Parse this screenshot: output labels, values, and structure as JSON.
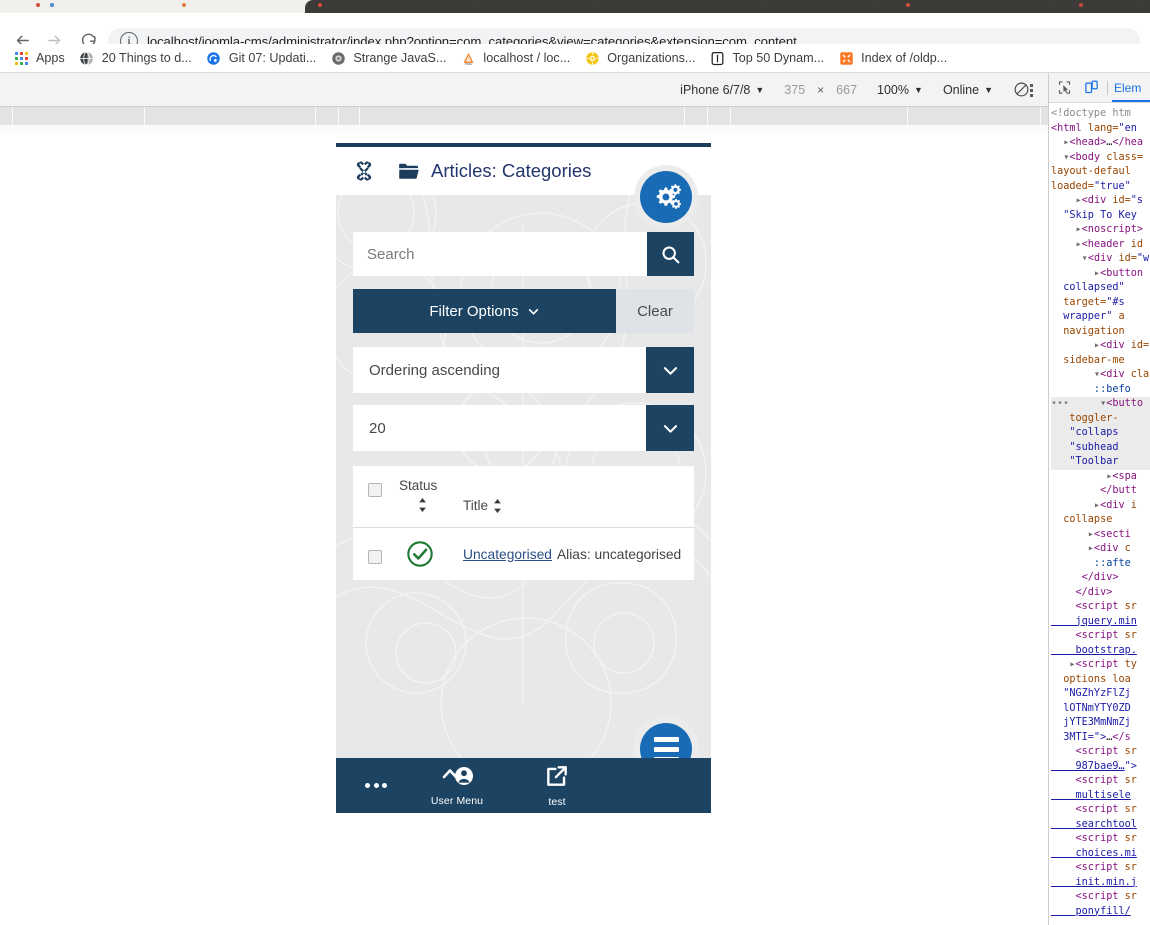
{
  "browser": {
    "url": "localhost/joomla-cms/administrator/index.php?option=com_categories&view=categories&extension=com_content",
    "back_icon": "arrow-left-icon",
    "forward_icon": "arrow-right-icon",
    "reload_icon": "reload-icon",
    "info_icon": "info-icon",
    "info_glyph": "i",
    "bookmarks": [
      {
        "label": "Apps",
        "icon": "apps-grid-icon"
      },
      {
        "label": "20 Things to d...",
        "icon": "globe-icon"
      },
      {
        "label": "Git 07: Updati...",
        "icon": "swirl-icon"
      },
      {
        "label": "Strange JavaS...",
        "icon": "circle-icon"
      },
      {
        "label": "localhost / loc...",
        "icon": "phpmyadmin-icon"
      },
      {
        "label": "Organizations...",
        "icon": "gear-yellow-icon"
      },
      {
        "label": "Top 50 Dynam...",
        "icon": "square-bracket-icon"
      },
      {
        "label": "Index of /oldp...",
        "icon": "xampp-icon"
      }
    ]
  },
  "device_toolbar": {
    "device": "iPhone 6/7/8",
    "device_caret": "chevron-down-icon",
    "width": "375",
    "times": "×",
    "height": "667",
    "zoom": "100%",
    "zoom_caret": "chevron-down-icon",
    "throttle": "Online",
    "throttle_caret": "chevron-down-icon",
    "rotate_icon": "rotate-device-icon",
    "more_icon": "kebab-menu-icon"
  },
  "viewport": {
    "header": {
      "logo_icon": "joomla-logo-icon",
      "section_icon": "folder-icon",
      "title": "Articles: Categories",
      "options_button_icon": "gears-icon"
    },
    "search": {
      "placeholder": "Search",
      "value": "",
      "button_icon": "search-icon"
    },
    "filter": {
      "options_label": "Filter Options",
      "options_caret": "chevron-down-icon",
      "clear_label": "Clear"
    },
    "ordering_select": {
      "value": "Ordering ascending",
      "caret": "chevron-down-icon"
    },
    "limit_select": {
      "value": "20",
      "caret": "chevron-down-icon"
    },
    "table": {
      "select_all_name": "select-all-checkbox",
      "columns": [
        {
          "label": "Status",
          "sortable": true
        },
        {
          "label": "Title",
          "sortable": true
        }
      ],
      "rows": [
        {
          "checked": false,
          "status_icon": "check-circle-icon",
          "status": "Published",
          "title": "Uncategorised",
          "alias": "Alias: uncategorised"
        }
      ]
    },
    "bottom_bar": {
      "items": [
        {
          "label": "",
          "icon": "ellipsis-icon",
          "name": "more-button"
        },
        {
          "label": "User Menu",
          "icon": "user-icon",
          "name": "user-menu-button"
        },
        {
          "label": "test",
          "icon": "external-link-icon",
          "name": "site-preview-button"
        }
      ],
      "menu_button_icon": "hamburger-icon"
    }
  },
  "devtools": {
    "inspect_icon": "inspect-element-icon",
    "device_toggle_icon": "device-toolbar-icon",
    "active_tab": "Elem",
    "code_lines": [
      [
        {
          "t": "com",
          "v": "<!doctype htm"
        }
      ],
      [
        {
          "t": "tag",
          "v": "<html"
        },
        {
          "t": "sp",
          "v": " "
        },
        {
          "t": "attr",
          "v": "lang="
        },
        {
          "t": "val",
          "v": "\"en"
        }
      ],
      [
        {
          "t": "tri",
          "v": "  ▸"
        },
        {
          "t": "tag",
          "v": "<head>"
        },
        {
          "t": "txt",
          "v": "…"
        },
        {
          "t": "tag",
          "v": "</hea"
        }
      ],
      [
        {
          "t": "tri",
          "v": "  ▾"
        },
        {
          "t": "tag",
          "v": "<body"
        },
        {
          "t": "sp",
          "v": " "
        },
        {
          "t": "attr",
          "v": "class="
        }
      ],
      [
        {
          "t": "attr",
          "v": "layout-defaul"
        }
      ],
      [
        {
          "t": "attr",
          "v": "loaded="
        },
        {
          "t": "val",
          "v": "\"true\""
        }
      ],
      [
        {
          "t": "tri",
          "v": "    ▸"
        },
        {
          "t": "tag",
          "v": "<div"
        },
        {
          "t": "sp",
          "v": " "
        },
        {
          "t": "attr",
          "v": "id="
        },
        {
          "t": "val",
          "v": "\"s"
        }
      ],
      [
        {
          "t": "val",
          "v": "  \"Skip To Key"
        }
      ],
      [
        {
          "t": "tri",
          "v": "    ▸"
        },
        {
          "t": "tag",
          "v": "<noscript>"
        }
      ],
      [
        {
          "t": "tri",
          "v": "    ▸"
        },
        {
          "t": "tag",
          "v": "<header"
        },
        {
          "t": "sp",
          "v": " "
        },
        {
          "t": "attr",
          "v": "id"
        }
      ],
      [
        {
          "t": "tri",
          "v": "     ▾"
        },
        {
          "t": "tag",
          "v": "<div"
        },
        {
          "t": "sp",
          "v": " "
        },
        {
          "t": "attr",
          "v": "id="
        },
        {
          "t": "val",
          "v": "\"w"
        }
      ],
      [
        {
          "t": "tri",
          "v": "       ▸"
        },
        {
          "t": "tag",
          "v": "<button"
        }
      ],
      [
        {
          "t": "val",
          "v": "  collapsed\""
        }
      ],
      [
        {
          "t": "attr",
          "v": "  target="
        },
        {
          "t": "val",
          "v": "\"#s"
        }
      ],
      [
        {
          "t": "val",
          "v": "  wrapper\""
        },
        {
          "t": "sp",
          "v": " "
        },
        {
          "t": "attr",
          "v": "a"
        }
      ],
      [
        {
          "t": "attr",
          "v": "  navigation"
        }
      ],
      [
        {
          "t": "tri",
          "v": "       ▸"
        },
        {
          "t": "tag",
          "v": "<div"
        },
        {
          "t": "sp",
          "v": " "
        },
        {
          "t": "attr",
          "v": "id="
        }
      ],
      [
        {
          "t": "attr",
          "v": "  sidebar-me"
        }
      ],
      [
        {
          "t": "tri",
          "v": "       ▾"
        },
        {
          "t": "tag",
          "v": "<div"
        },
        {
          "t": "sp",
          "v": " "
        },
        {
          "t": "attr",
          "v": "cla"
        }
      ],
      [
        {
          "t": "pseudo",
          "v": "       ::befo"
        }
      ],
      [
        {
          "t": "tri",
          "v": "        ▾"
        },
        {
          "t": "tag",
          "v": "<butto"
        }
      ],
      [
        {
          "t": "attr",
          "v": "   toggler-"
        }
      ],
      [
        {
          "t": "val",
          "v": "   \"collaps"
        }
      ],
      [
        {
          "t": "val",
          "v": "   \"subhead"
        }
      ],
      [
        {
          "t": "val",
          "v": "   \"Toolbar"
        }
      ],
      [
        {
          "t": "tri",
          "v": "         ▸"
        },
        {
          "t": "tag",
          "v": "<spa"
        }
      ],
      [
        {
          "t": "tag",
          "v": "        </butt"
        }
      ],
      [
        {
          "t": "tri",
          "v": "       ▸"
        },
        {
          "t": "tag",
          "v": "<div"
        },
        {
          "t": "sp",
          "v": " "
        },
        {
          "t": "attr",
          "v": "i"
        }
      ],
      [
        {
          "t": "attr",
          "v": "  collapse"
        }
      ],
      [
        {
          "t": "tri",
          "v": "      ▸"
        },
        {
          "t": "tag",
          "v": "<secti"
        }
      ],
      [
        {
          "t": "tri",
          "v": "      ▸"
        },
        {
          "t": "tag",
          "v": "<div"
        },
        {
          "t": "sp",
          "v": " "
        },
        {
          "t": "attr",
          "v": "c"
        }
      ],
      [
        {
          "t": "pseudo",
          "v": "       ::afte"
        }
      ],
      [
        {
          "t": "tag",
          "v": "     </div>"
        }
      ],
      [
        {
          "t": "tag",
          "v": "    </div>"
        }
      ],
      [
        {
          "t": "tag",
          "v": "    <script"
        },
        {
          "t": "sp",
          "v": " "
        },
        {
          "t": "attr",
          "v": "sr"
        }
      ],
      [
        {
          "t": "link",
          "v": "    jquery.min"
        }
      ],
      [
        {
          "t": "tag",
          "v": "    <script"
        },
        {
          "t": "sp",
          "v": " "
        },
        {
          "t": "attr",
          "v": "sr"
        }
      ],
      [
        {
          "t": "link",
          "v": "    bootstrap."
        }
      ],
      [
        {
          "t": "tri",
          "v": "   ▸"
        },
        {
          "t": "tag",
          "v": "<script"
        },
        {
          "t": "sp",
          "v": " "
        },
        {
          "t": "attr",
          "v": "ty"
        }
      ],
      [
        {
          "t": "attr",
          "v": "  options loa"
        }
      ],
      [
        {
          "t": "val",
          "v": "  \"NGZhYzFlZj"
        }
      ],
      [
        {
          "t": "val",
          "v": "  lOTNmYTY0ZD"
        }
      ],
      [
        {
          "t": "val",
          "v": "  jYTE3MmNmZj"
        }
      ],
      [
        {
          "t": "val",
          "v": "  3MTI=\">"
        },
        {
          "t": "txt",
          "v": "…"
        },
        {
          "t": "tag",
          "v": "</s"
        }
      ],
      [
        {
          "t": "tag",
          "v": "    <script"
        },
        {
          "t": "sp",
          "v": " "
        },
        {
          "t": "attr",
          "v": "sr"
        }
      ],
      [
        {
          "t": "link",
          "v": "    987bae9…"
        },
        {
          "t": "val",
          "v": "\">"
        }
      ],
      [
        {
          "t": "tag",
          "v": "    <script"
        },
        {
          "t": "sp",
          "v": " "
        },
        {
          "t": "attr",
          "v": "sr"
        }
      ],
      [
        {
          "t": "link",
          "v": "    multisele"
        }
      ],
      [
        {
          "t": "tag",
          "v": "    <script"
        },
        {
          "t": "sp",
          "v": " "
        },
        {
          "t": "attr",
          "v": "sr"
        }
      ],
      [
        {
          "t": "link",
          "v": "    searchtool"
        }
      ],
      [
        {
          "t": "tag",
          "v": "    <script"
        },
        {
          "t": "sp",
          "v": " "
        },
        {
          "t": "attr",
          "v": "sr"
        }
      ],
      [
        {
          "t": "link",
          "v": "    choices.mi"
        }
      ],
      [
        {
          "t": "tag",
          "v": "    <script"
        },
        {
          "t": "sp",
          "v": " "
        },
        {
          "t": "attr",
          "v": "sr"
        }
      ],
      [
        {
          "t": "link",
          "v": "    init.min.j"
        }
      ],
      [
        {
          "t": "tag",
          "v": "    <script"
        },
        {
          "t": "sp",
          "v": " "
        },
        {
          "t": "attr",
          "v": "sr"
        }
      ],
      [
        {
          "t": "link",
          "v": "    ponyfill/"
        }
      ]
    ]
  },
  "colors": {
    "joomla_dark": "#1c4462",
    "joomla_blue": "#1a6bb5",
    "title_navy": "#22356c",
    "link_blue": "#2b4f86",
    "status_green": "#1d7a33",
    "devtools_accent": "#1a73e8"
  }
}
